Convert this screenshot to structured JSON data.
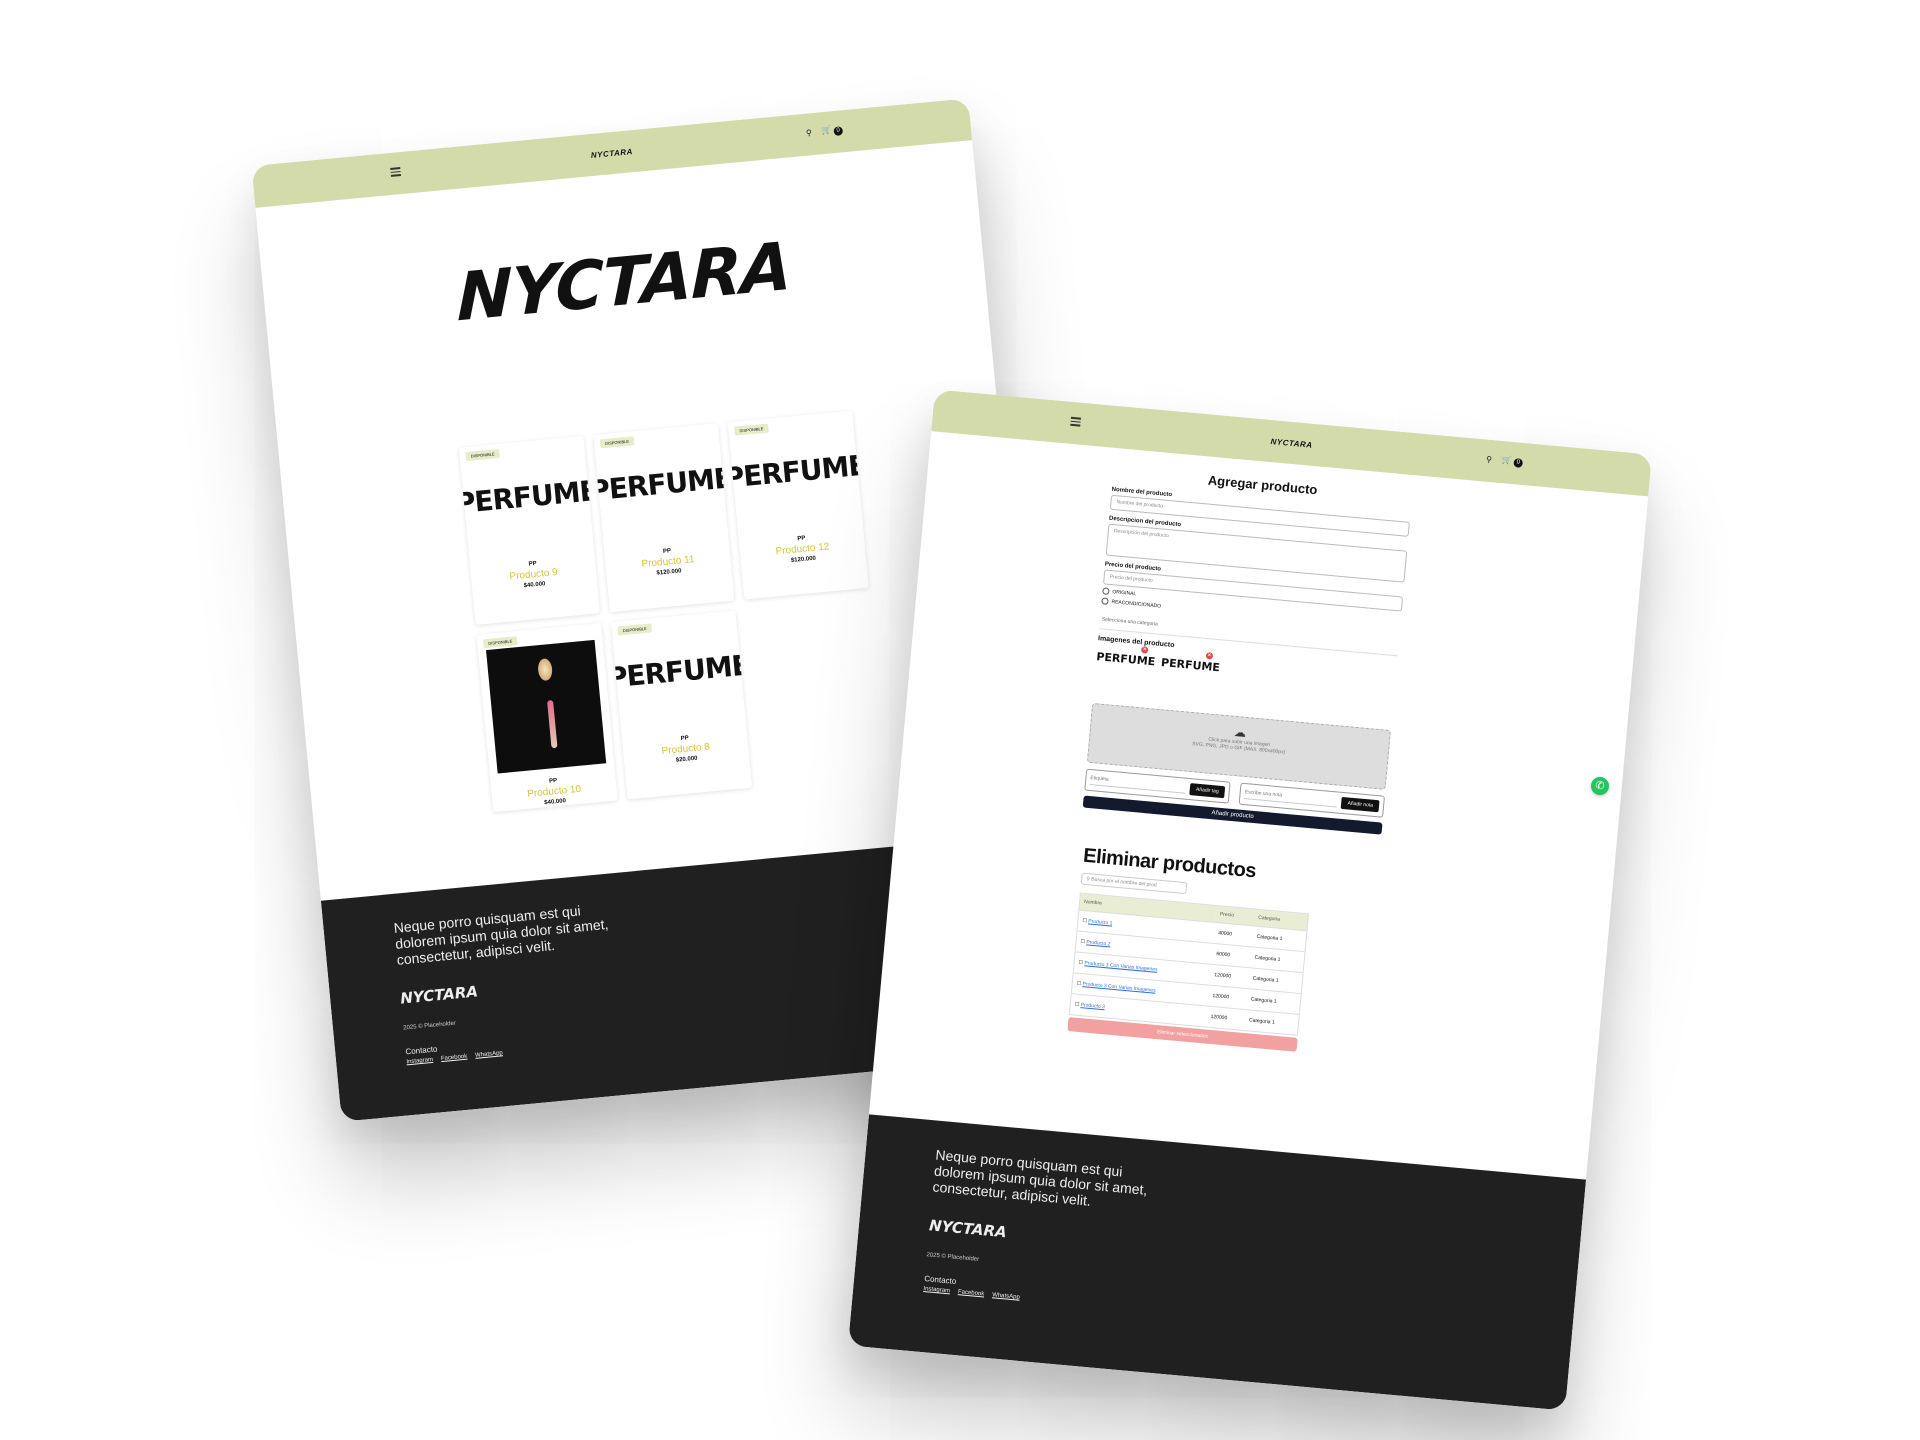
{
  "brand": "NYCTARA",
  "storefront": {
    "cart_count": "0",
    "products": [
      {
        "badge": "DISPONIBLE",
        "image_text": "PERFUME",
        "brand": "PP",
        "name": "Producto 9",
        "price": "$40.000"
      },
      {
        "badge": "DISPONIBLE",
        "image_text": "PERFUME",
        "brand": "PP",
        "name": "Producto 11",
        "price": "$120.000"
      },
      {
        "badge": "DISPONIBLE",
        "image_text": "PERFUME",
        "brand": "PP",
        "name": "Producto 12",
        "price": "$120.000"
      },
      {
        "badge": "DISPONIBLE",
        "image_text": "",
        "brand": "PP",
        "name": "Producto 10",
        "price": "$40.000"
      },
      {
        "badge": "DISPONIBLE",
        "image_text": "PERFUME",
        "brand": "PP",
        "name": "Producto 8",
        "price": "$20.000"
      }
    ]
  },
  "footer": {
    "blurb": "Neque porro quisquam est qui dolorem ipsum quia dolor sit amet, consectetur, adipisci velit.",
    "copyright": "2025 © Placeholder",
    "contact_label": "Contacto",
    "links": [
      "Instagram",
      "Facebook",
      "WhatsApp"
    ]
  },
  "admin": {
    "cart_count": "0",
    "add_title": "Agregar producto",
    "name_label": "Nombre del producto",
    "name_placeholder": "Nombre del producto",
    "desc_label": "Descripcion del producto",
    "desc_placeholder": "Descripción del producto",
    "price_label": "Precio del producto",
    "price_placeholder": "Precio del producto",
    "radio_options": [
      "ORIGINAL",
      "REACONDICIONADO"
    ],
    "category_placeholder": "Selecciona una categoria",
    "images_title": "Imagenes del producto",
    "thumbs": [
      "PERFUME",
      "PERFUME"
    ],
    "upload_text": "Click para subir una imagen",
    "upload_hint": "SVG, PNG, JPG o GIF (MAX. 800x400px)",
    "tag_placeholder": "Etiqueta",
    "tag_button": "Añadir tag",
    "note_placeholder": "Escribe una nota",
    "note_button": "Añadir nota",
    "add_button": "Añadir producto",
    "delete_title": "Eliminar productos",
    "search_placeholder": "Busca por el nombre del prod",
    "table_headers": [
      "Nombre",
      "Precio",
      "Categoria"
    ],
    "rows": [
      {
        "name": "Producto 1",
        "price": "40000",
        "category": "Categoria 1"
      },
      {
        "name": "Producto 2",
        "price": "60000",
        "category": "Categoria 1"
      },
      {
        "name": "Producto 3 Con Varias Imagenes",
        "price": "120000",
        "category": "Categoria 1"
      },
      {
        "name": "Producto 3 Con Varias Imagenes",
        "price": "120000",
        "category": "Categoria 1"
      },
      {
        "name": "Producto 3",
        "price": "120000",
        "category": "Categoria 1"
      }
    ],
    "delete_button": "Eliminar seleccionados"
  }
}
